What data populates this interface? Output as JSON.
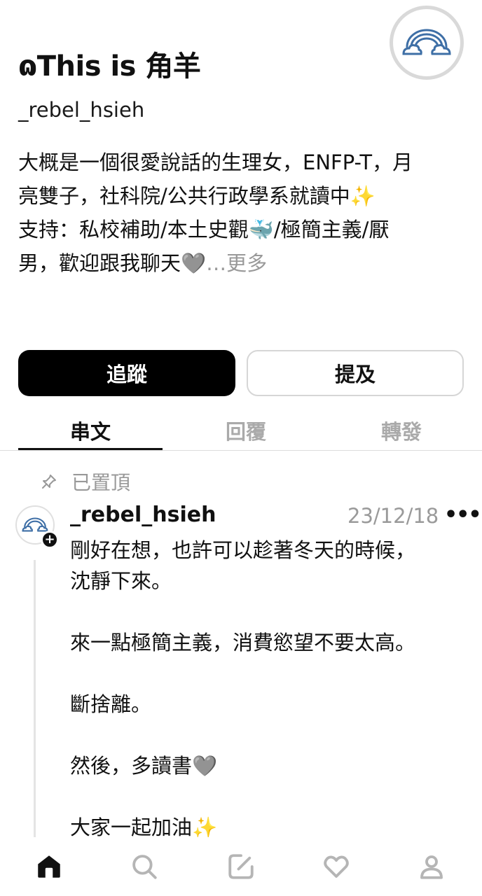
{
  "profile": {
    "name": "ɷThis is 角羊",
    "handle": "_rebel_hsieh",
    "bio": {
      "line1": "大概是一個很愛說話的生理女，ENFP-T，月",
      "line2": "亮雙子，社科院/公共行政學系就讀中✨",
      "line3": "支持：私校補助/本土史觀🐳/極簡主義/厭",
      "line4": "男，歡迎跟我聊天🩶",
      "more": "…更多"
    },
    "avatar_icon": "rainbow-icon"
  },
  "buttons": {
    "follow": "追蹤",
    "mention": "提及"
  },
  "tabs": [
    {
      "label": "串文",
      "active": true
    },
    {
      "label": "回覆",
      "active": false
    },
    {
      "label": "轉發",
      "active": false
    }
  ],
  "post": {
    "pinned_label": "已置頂",
    "username": "_rebel_hsieh",
    "date": "23/12/18",
    "more": "•••",
    "lines": [
      "剛好在想，也許可以趁著冬天的時候，",
      "沈靜下來。",
      "來一點極簡主義，消費慾望不要太高。",
      "斷捨離。",
      "然後，多讀書🩶",
      "大家一起加油✨"
    ]
  },
  "nav": [
    "home-icon",
    "search-icon",
    "compose-icon",
    "heart-icon",
    "profile-icon"
  ],
  "colors": {
    "primary": "#000000",
    "muted": "#999999",
    "accent_rainbow": "#3e6fa6"
  }
}
